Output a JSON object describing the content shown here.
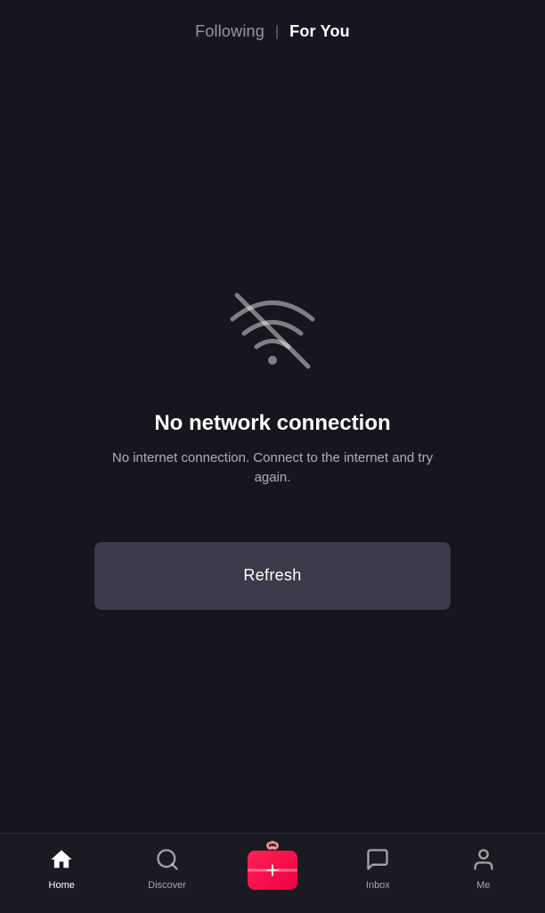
{
  "header": {
    "following_label": "Following",
    "for_you_label": "For You",
    "active_tab": "for_you",
    "divider": "|"
  },
  "error": {
    "icon_name": "no-wifi-icon",
    "title": "No network connection",
    "subtitle": "No internet connection. Connect to the internet and try again.",
    "refresh_button_label": "Refresh"
  },
  "bottom_nav": {
    "items": [
      {
        "id": "home",
        "label": "Home",
        "active": true
      },
      {
        "id": "discover",
        "label": "Discover",
        "active": false
      },
      {
        "id": "plus",
        "label": "",
        "active": false
      },
      {
        "id": "inbox",
        "label": "Inbox",
        "active": false
      },
      {
        "id": "me",
        "label": "Me",
        "active": false
      }
    ]
  }
}
